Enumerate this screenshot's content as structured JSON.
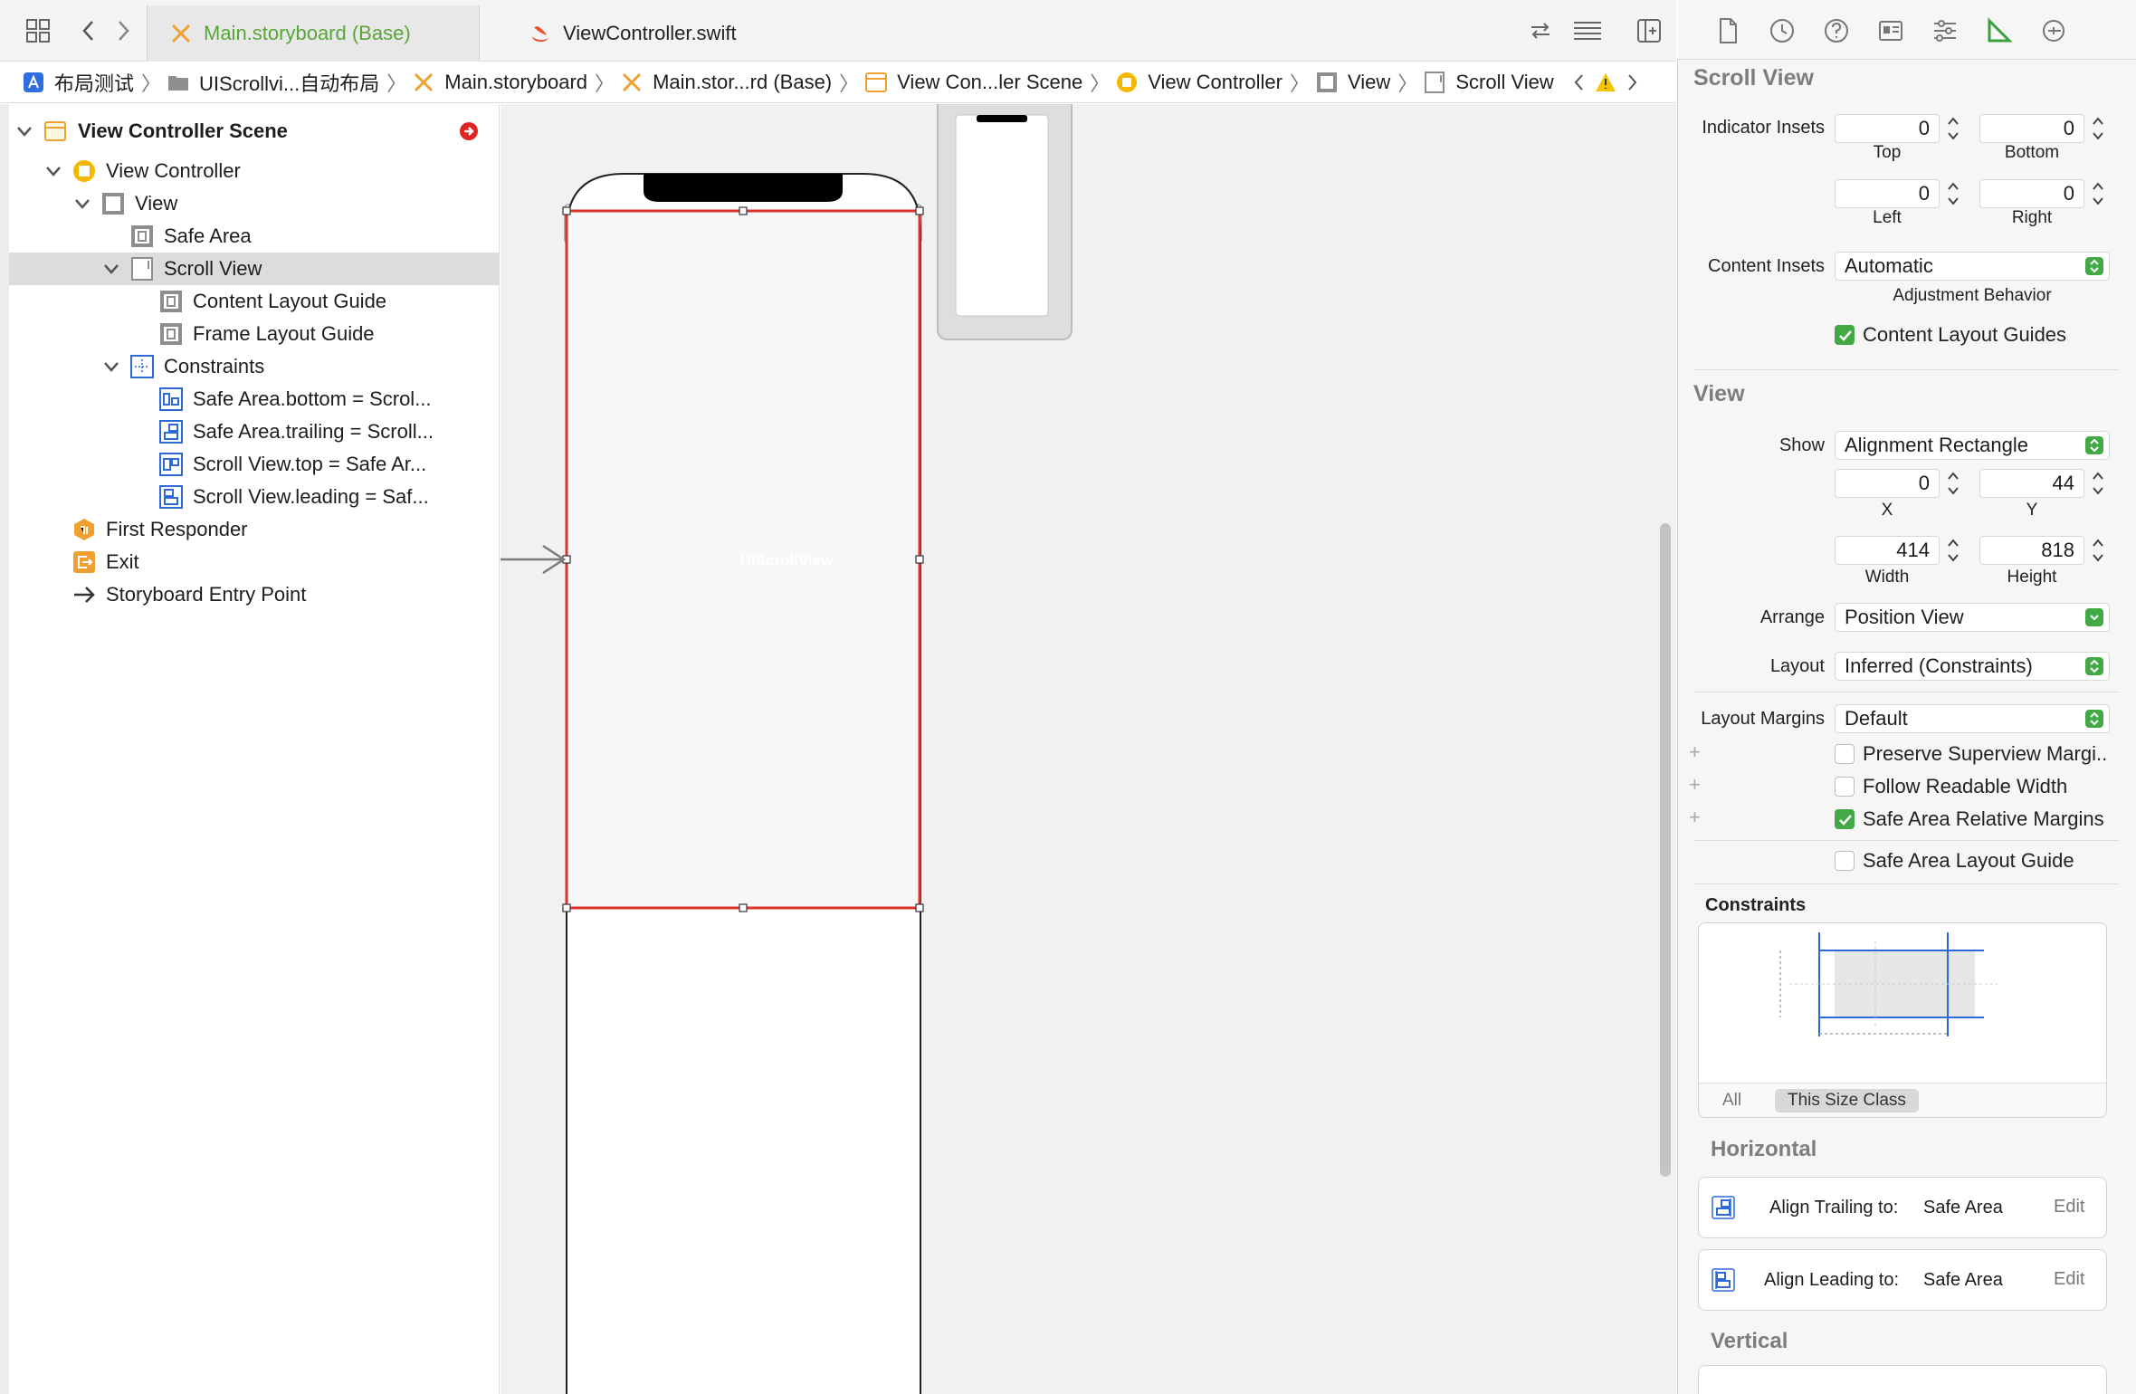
{
  "tabs": [
    {
      "label": "Main.storyboard (Base)",
      "active": true
    },
    {
      "label": "ViewController.swift",
      "active": false
    }
  ],
  "breadcrumb": [
    "布局测试",
    "UIScrollvi...自动布局",
    "Main.storyboard",
    "Main.stor...rd (Base)",
    "View Con...ler Scene",
    "View Controller",
    "View",
    "Scroll View"
  ],
  "outline": {
    "scene_title": "View Controller Scene",
    "items": [
      {
        "label": "View Controller"
      },
      {
        "label": "View"
      },
      {
        "label": "Safe Area"
      },
      {
        "label": "Scroll View"
      },
      {
        "label": "Content Layout Guide"
      },
      {
        "label": "Frame Layout Guide"
      },
      {
        "label": "Constraints"
      },
      {
        "label": "Safe Area.bottom = Scrol..."
      },
      {
        "label": "Safe Area.trailing = Scroll..."
      },
      {
        "label": "Scroll View.top = Safe Ar..."
      },
      {
        "label": "Scroll View.leading = Saf..."
      },
      {
        "label": "First Responder"
      },
      {
        "label": "Exit"
      },
      {
        "label": "Storyboard Entry Point"
      }
    ]
  },
  "canvas": {
    "scroll_view_label": "UIScrollView"
  },
  "inspector": {
    "scroll_view": {
      "title": "Scroll View",
      "indicator_insets_label": "Indicator Insets",
      "top": "0",
      "bottom": "0",
      "left": "0",
      "right": "0",
      "top_label": "Top",
      "bottom_label": "Bottom",
      "left_label": "Left",
      "right_label": "Right",
      "content_insets_label": "Content Insets",
      "content_insets_value": "Automatic",
      "adjustment_label": "Adjustment Behavior",
      "content_layout_guides_label": "Content Layout Guides",
      "content_layout_guides_checked": true
    },
    "view": {
      "title": "View",
      "show_label": "Show",
      "show_value": "Alignment Rectangle",
      "x": "0",
      "y": "44",
      "width": "414",
      "height": "818",
      "x_label": "X",
      "y_label": "Y",
      "width_label": "Width",
      "height_label": "Height",
      "arrange_label": "Arrange",
      "arrange_value": "Position View",
      "layout_label": "Layout",
      "layout_value": "Inferred (Constraints)",
      "layout_margins_label": "Layout Margins",
      "layout_margins_value": "Default",
      "preserve_label": "Preserve Superview Margi..",
      "follow_label": "Follow Readable Width",
      "safe_rel_label": "Safe Area Relative Margins",
      "safe_guide_label": "Safe Area Layout Guide",
      "preserve_checked": false,
      "follow_checked": false,
      "safe_rel_checked": true,
      "safe_guide_checked": false
    },
    "constraints": {
      "title": "Constraints",
      "seg_all": "All",
      "seg_size_class": "This Size Class",
      "horizontal_title": "Horizontal",
      "items": [
        {
          "label": "Align Trailing to:",
          "target": "Safe Area",
          "edit": "Edit"
        },
        {
          "label": "Align Leading to:",
          "target": "Safe Area",
          "edit": "Edit"
        }
      ],
      "vertical_title": "Vertical"
    }
  },
  "colors": {
    "accent_green": "#5aa53a",
    "selection_red": "#d9342b",
    "check_green": "#43a946",
    "constraint_blue": "#2d6ad6",
    "storyboard_orange": "#f0a030"
  }
}
